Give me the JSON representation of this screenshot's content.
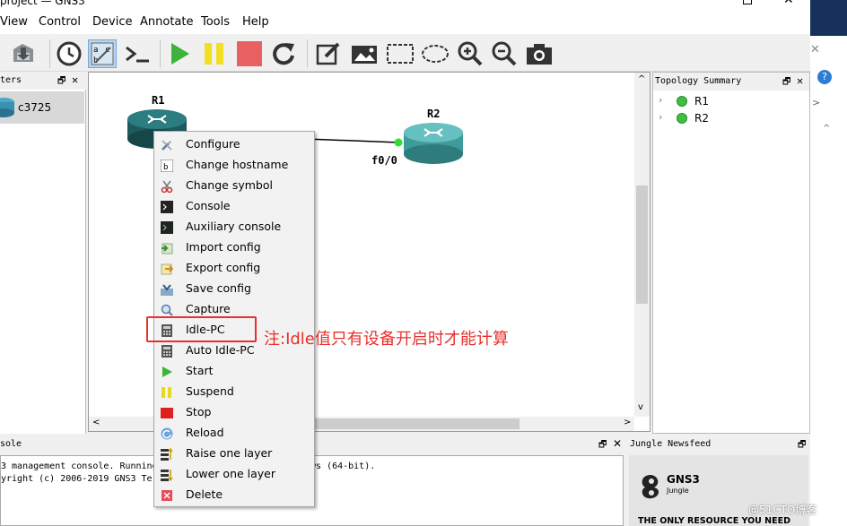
{
  "window": {
    "title": "project — GNS3"
  },
  "menu": {
    "items": [
      "View",
      "Control",
      "Device",
      "Annotate",
      "Tools",
      "Help"
    ]
  },
  "left_dock": {
    "title": "ters",
    "device": "c3725"
  },
  "canvas": {
    "r1_label": "R1",
    "r2_label": "R2",
    "r2_port": "f0/0"
  },
  "topology": {
    "title": "Topology Summary",
    "nodes": [
      "R1",
      "R2"
    ],
    "node_status_color": "#3fbf3f"
  },
  "context_menu": {
    "items": [
      "Configure",
      "Change hostname",
      "Change symbol",
      "Console",
      "Auxiliary console",
      "Import config",
      "Export config",
      "Save config",
      "Capture",
      "Idle-PC",
      "Auto Idle-PC",
      "Start",
      "Suspend",
      "Stop",
      "Reload",
      "Raise one layer",
      "Lower one layer",
      "Delete"
    ]
  },
  "annotation": {
    "text": "注:Idle值只有设备开启时才能计算",
    "color": "#e8302c"
  },
  "console": {
    "title": "sole",
    "line1": "3 management console. Running",
    "line1b": "ws (64-bit).",
    "line2": "yright (c) 2006-2019 GNS3 Te"
  },
  "news": {
    "title": "Jungle Newsfeed",
    "logo_text": "GNS3",
    "logo_sub": "Jungle",
    "banner": "THE ONLY RESOURCE YOU NEED"
  },
  "watermark": "@51CTO博客",
  "colors": {
    "accent_red": "#e8302c",
    "start_green": "#3cb43c",
    "pause_yellow": "#f0e020",
    "stop_red": "#e86060"
  }
}
